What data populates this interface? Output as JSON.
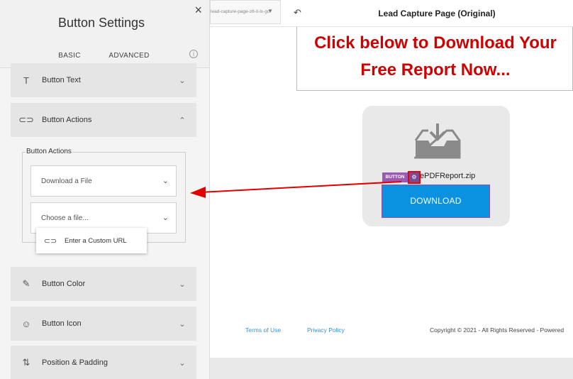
{
  "panel": {
    "title": "Button Settings",
    "close_glyph": "×",
    "tabs": [
      {
        "label": "BASIC",
        "active": true
      },
      {
        "label": "ADVANCED",
        "active": false
      }
    ],
    "info_glyph": "i",
    "sections": {
      "button_text": {
        "label": "Button Text",
        "icon": "text-size-icon",
        "glyph": "T"
      },
      "button_actions": {
        "label": "Button Actions",
        "icon": "link-icon",
        "glyph": "⊂⊃"
      },
      "button_color": {
        "label": "Button Color",
        "icon": "eyedropper-icon",
        "glyph": "✎"
      },
      "button_icon": {
        "label": "Button Icon",
        "icon": "smiley-icon",
        "glyph": "☺"
      },
      "position_padding": {
        "label": "Position & Padding",
        "icon": "sort-arrows-icon",
        "glyph": "⇅"
      }
    },
    "actions_group": {
      "legend": "Button Actions",
      "action_select": {
        "value": "Download a File"
      },
      "file_select": {
        "placeholder": "Choose a file..."
      },
      "dropdown_option": {
        "label": "Enter a Custom URL",
        "icon": "link-icon",
        "glyph": "⊂⊃"
      }
    }
  },
  "topbar": {
    "page_select_value": "lead-capture-page-z8-it-lx-gc",
    "undo_glyph": "↶",
    "page_name": "Lead Capture Page (Original)"
  },
  "canvas": {
    "headline": "Click below to Download Your Free Report Now...",
    "filename": "ePDFReport.zip",
    "badge": "BUTTON",
    "gear_glyph": "⚙",
    "download_label": "DOWNLOAD",
    "footer": {
      "terms": "Terms of Use",
      "privacy": "Privacy Policy",
      "copyright": "Copyright © 2021 - All Rights Reserved - Powered"
    }
  },
  "colors": {
    "accent_tab": "#e0245e",
    "headline": "#d00000",
    "download_button": "#0a92e0",
    "badge": "#9b59b6",
    "arrow": "#e00000"
  }
}
